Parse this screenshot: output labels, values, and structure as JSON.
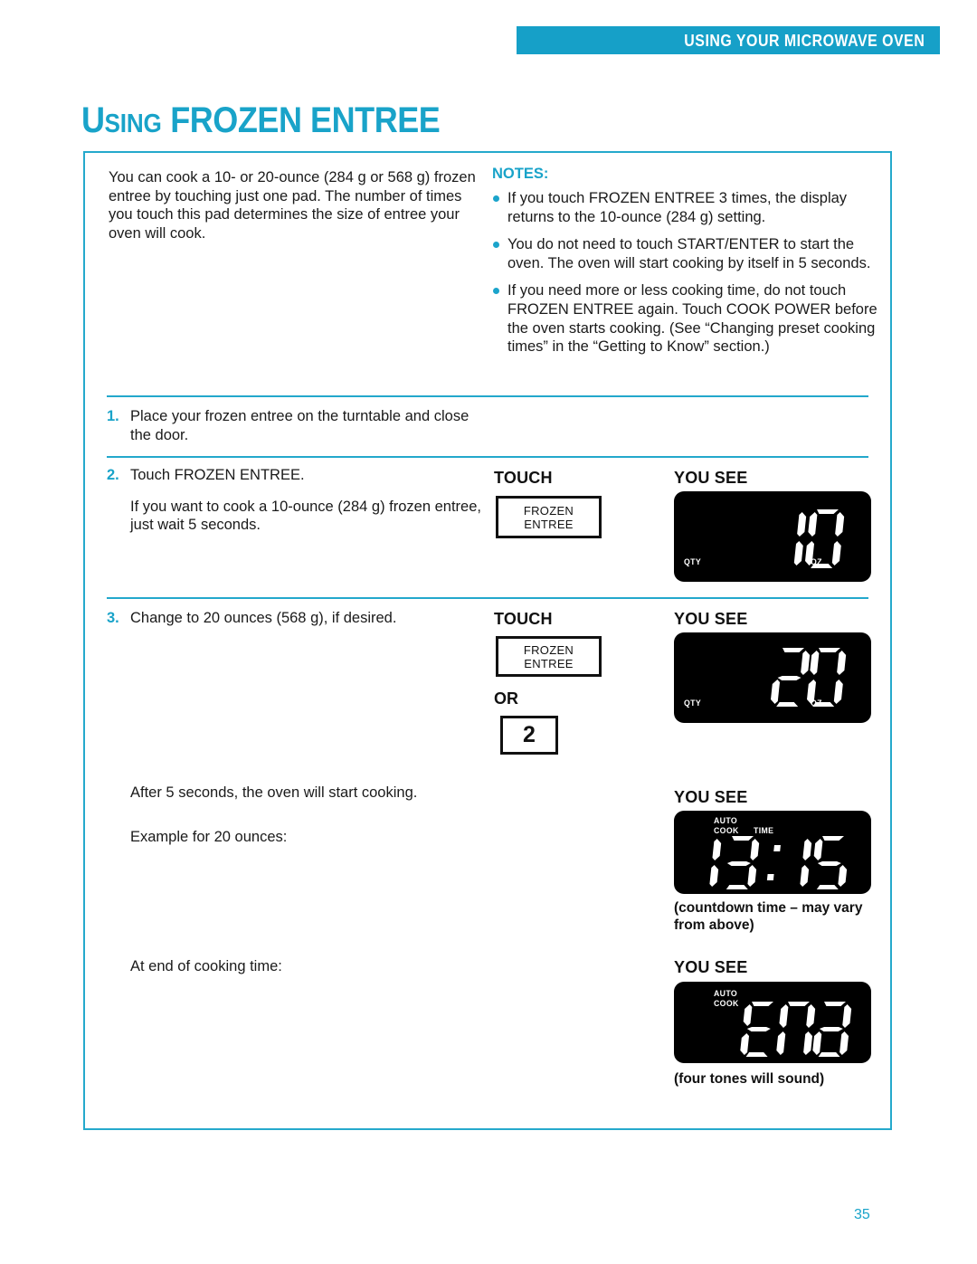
{
  "header": {
    "banner_text": "USING YOUR MICROWAVE OVEN",
    "banner_color": "#16a0c8"
  },
  "title": {
    "cap": "U",
    "small_caps": "SING",
    "rest": " FROZEN ENTREE",
    "full": "USING FROZEN ENTREE",
    "color": "#19a3c9"
  },
  "intro": {
    "paragraph": "You can cook a 10- or 20-ounce (284 g or 568 g) frozen entree by touching just one pad. The number of times you touch this pad determines the size of entree your oven will cook."
  },
  "notes": {
    "heading": "NOTES:",
    "items": [
      "If you touch FROZEN ENTREE 3 times, the display returns to the 10-ounce (284 g) setting.",
      "You do not need to touch START/ENTER to start the oven. The oven will start cooking by itself in 5 seconds.",
      "If you need more or less cooking time, do not touch FROZEN ENTREE again. Touch COOK POWER before the oven starts cooking. (See “Changing preset cooking times” in the “Getting to Know” section.)"
    ]
  },
  "steps": [
    {
      "number": "1.",
      "text": "Place your frozen entree on the turntable and close the door."
    },
    {
      "number": "2.",
      "text": "Touch FROZEN ENTREE.",
      "sub": "If you want to cook a 10-ounce (284 g) frozen entree, just wait 5 seconds."
    },
    {
      "number": "3.",
      "text": "Change to 20 ounces (568 g), if desired."
    }
  ],
  "extra_lines": {
    "after_5_seconds": "After 5 seconds, the oven will start cooking.",
    "example": "Example for 20 ounces:",
    "at_end": "At end of cooking time:"
  },
  "labels": {
    "touch": "TOUCH",
    "you_see": "YOU SEE",
    "or": "OR"
  },
  "pads": {
    "frozen_entree_line1": "FROZEN",
    "frozen_entree_line2": "ENTREE",
    "number_two": "2"
  },
  "displays": [
    {
      "name": "qty-10-oz",
      "value": "10",
      "left_label": "QTY",
      "right_label": "OZ"
    },
    {
      "name": "qty-20-oz",
      "value": "20",
      "left_label": "QTY",
      "right_label": "OZ"
    },
    {
      "name": "countdown",
      "value": "13:15",
      "indicator_line1": "AUTO",
      "indicator_line2": "COOK",
      "indicator_time": "TIME",
      "caption": "(countdown time – may vary from above)"
    },
    {
      "name": "end",
      "value": "END",
      "indicator_line1": "AUTO",
      "indicator_line2": "COOK",
      "caption": "(four tones will sound)"
    }
  ],
  "footer": {
    "page_number": "35"
  }
}
